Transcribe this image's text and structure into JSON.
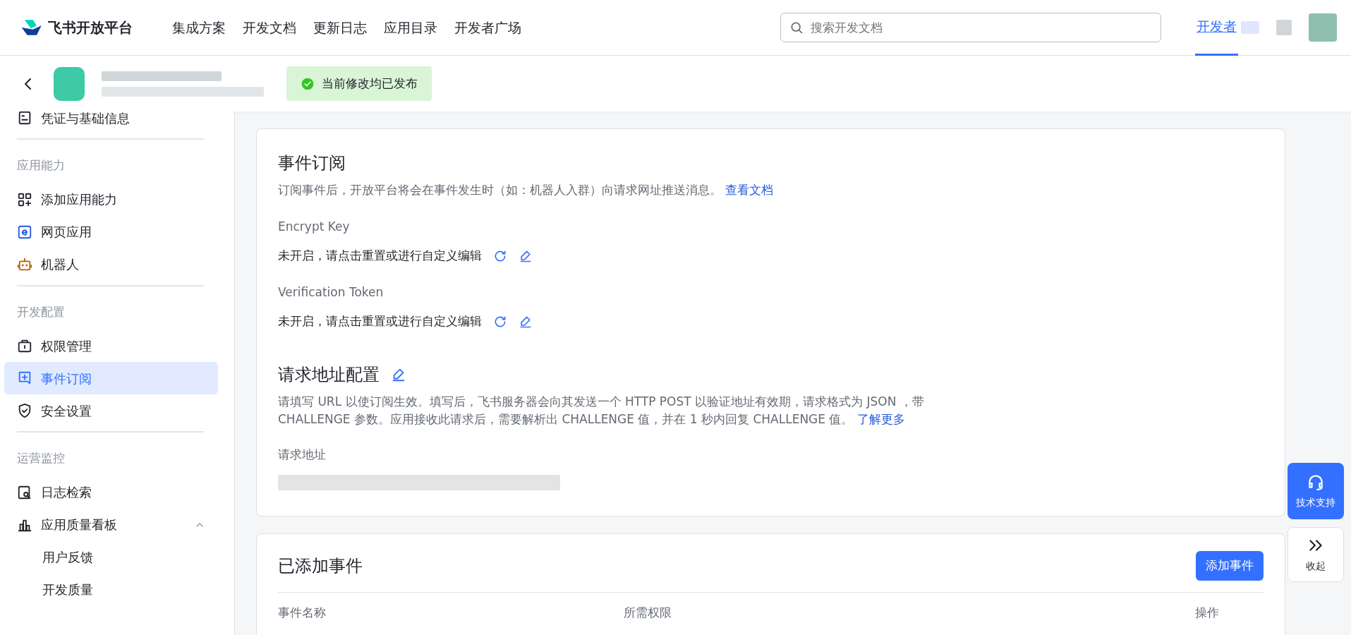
{
  "topnav": {
    "logo": "飞书开放平台",
    "links": [
      "集成方案",
      "开发文档",
      "更新日志",
      "应用目录",
      "开发者广场"
    ],
    "search": {
      "placeholder": "搜索开发文档"
    },
    "account_tab": {
      "label": "开发者",
      "selected": true
    }
  },
  "app_bar": {
    "status": "当前修改均已发布"
  },
  "sidebar": {
    "groups": [
      {
        "items": [
          {
            "label": "凭证与基础信息",
            "selected": false
          }
        ]
      },
      {
        "title": "应用能力",
        "items": [
          {
            "label": "添加应用能力",
            "selected": false
          },
          {
            "label": "网页应用",
            "selected": false
          },
          {
            "label": "机器人",
            "selected": false
          }
        ]
      },
      {
        "title": "开发配置",
        "items": [
          {
            "label": "权限管理",
            "selected": false
          },
          {
            "label": "事件订阅",
            "selected": true
          },
          {
            "label": "安全设置",
            "selected": false
          }
        ]
      },
      {
        "title": "运营监控",
        "items": [
          {
            "label": "日志检索",
            "selected": false
          },
          {
            "label": "应用质量看板",
            "selected": false,
            "expanded": true,
            "children": [
              {
                "label": "用户反馈",
                "selected": false
              },
              {
                "label": "开发质量",
                "selected": false
              }
            ]
          }
        ]
      }
    ]
  },
  "event_card": {
    "title": "事件订阅",
    "description": "订阅事件后，开放平台将会在事件发生时（如：机器人入群）向请求网址推送消息。",
    "doc_link": "查看文档",
    "fields": [
      {
        "label": "Encrypt Key",
        "value": "未开启，请点击重置或进行自定义编辑"
      },
      {
        "label": "Verification Token",
        "value": "未开启，请点击重置或进行自定义编辑"
      }
    ],
    "request_config": {
      "title": "请求地址配置",
      "description": "请填写 URL 以使订阅生效。填写后，飞书服务器会向其发送一个 HTTP POST 以验证地址有效期，请求格式为 JSON ，带 CHALLENGE 参数。应用接收此请求后，需要解析出 CHALLENGE 值，并在 1 秒内回复 CHALLENGE 值。",
      "link": "了解更多",
      "address_label": "请求地址"
    }
  },
  "events_card": {
    "title": "已添加事件",
    "add_button": "添加事件",
    "columns": [
      "事件名称",
      "所需权限",
      "操作"
    ]
  },
  "float": {
    "support": "技术支持",
    "collapse": "收起"
  }
}
